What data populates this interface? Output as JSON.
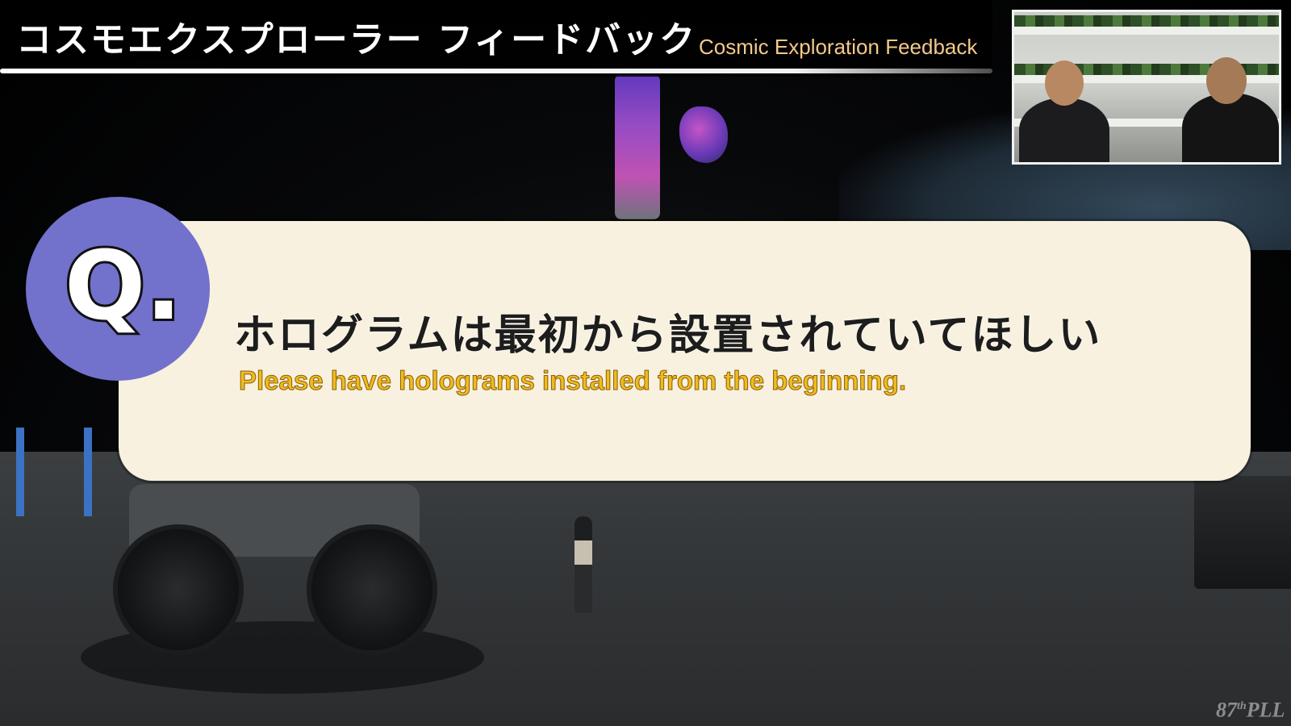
{
  "header": {
    "title_jp": "コスモエクスプローラー フィードバック",
    "title_en": "Cosmic Exploration Feedback"
  },
  "question": {
    "badge": "Q.",
    "text_jp": "ホログラムは最初から設置されていてほしい",
    "text_en": "Please have holograms installed from the beginning."
  },
  "watermark": {
    "number": "87",
    "suffix": "th",
    "label": "PLL"
  },
  "colors": {
    "badge": "#7271cc",
    "card": "#f8f1df",
    "subtitle_en": "#f0bb21",
    "title_en": "#f3c98a"
  }
}
